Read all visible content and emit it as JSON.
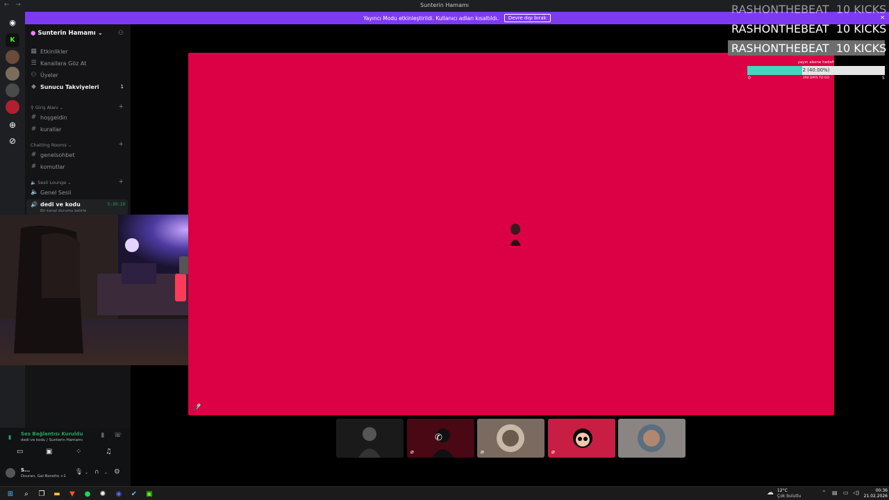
{
  "window": {
    "title": "Sunterin Hamamı",
    "banner_text": "Yayıncı Modu etkinleştirildi. Kullanıcı adları kısaltıldı.",
    "banner_button": "Devre dışı bırak"
  },
  "server": {
    "name": "Sunterin Hamamı",
    "menu": [
      {
        "label": "Etkinlikler",
        "icon": "calendar-icon"
      },
      {
        "label": "Kanallara Göz At",
        "icon": "browse-channels-icon"
      },
      {
        "label": "Üyeler",
        "icon": "members-icon"
      },
      {
        "label": "Sunucu Takviyeleri",
        "icon": "boost-icon",
        "badge": "1"
      }
    ],
    "categories": [
      {
        "name": "Giriş Alanı",
        "channels": [
          "hoşgeldin",
          "kurallar"
        ]
      },
      {
        "name": "Chatting Rooms",
        "channels": [
          "genelsohbet",
          "komutlar"
        ]
      },
      {
        "name": "Sesli Lounge",
        "channels": [
          "Genel Sesli"
        ]
      }
    ],
    "active_voice": {
      "name": "dedi ve kodu",
      "timer": "5:30:19",
      "status": "Bir kanal durumu belirle"
    }
  },
  "voice_panel": {
    "status": "Ses Bağlantısı Kuruldu",
    "location": "dedi ve kodu / Sunterin Hamamı",
    "user_name": "S...",
    "user_activity": "Douran, Gai Boratto +1"
  },
  "overlay": {
    "kicks": [
      {
        "user": "RASHONTHEBEAT",
        "count": "10 KICKS"
      },
      {
        "user": "RASHONTHEBEAT",
        "count": "10 KICKS"
      },
      {
        "user": "RASHONTHEBEAT",
        "count": "10 KICKS"
      }
    ],
    "goal_title": "yayın abone hedefi",
    "goal_value": "2 (40.00%)",
    "goal_fraction": 0.4,
    "goal_min": "0",
    "goal_sub": "294 DAYS TO GO",
    "goal_max": "5"
  },
  "taskbar": {
    "weather_temp": "12°C",
    "weather_desc": "Çok bulutlu",
    "time": "00:36",
    "date": "21.02.2026"
  },
  "colors": {
    "stage": "#dc0044",
    "accent": "#7e3af2",
    "goal_fill": "#45d6c2",
    "voice_green": "#23a55a"
  }
}
